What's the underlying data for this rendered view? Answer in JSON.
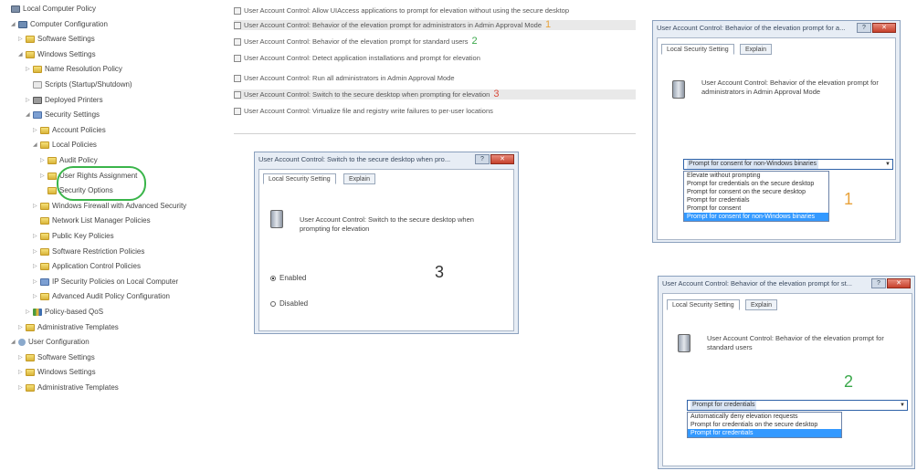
{
  "tree": [
    {
      "label": "Local Computer Policy",
      "icon": "policy-icon",
      "indent": 0,
      "expander": ""
    },
    {
      "label": "Computer Configuration",
      "icon": "computer-icon",
      "indent": 1,
      "expander": "◢"
    },
    {
      "label": "Software Settings",
      "icon": "folder-icon",
      "indent": 2,
      "expander": "▷"
    },
    {
      "label": "Windows Settings",
      "icon": "folder-icon",
      "indent": 2,
      "expander": "◢"
    },
    {
      "label": "Name Resolution Policy",
      "icon": "folder-icon",
      "indent": 3,
      "expander": "▷"
    },
    {
      "label": "Scripts (Startup/Shutdown)",
      "icon": "doc-icon",
      "indent": 3,
      "expander": ""
    },
    {
      "label": "Deployed Printers",
      "icon": "printer-icon",
      "indent": 3,
      "expander": "▷"
    },
    {
      "label": "Security Settings",
      "icon": "shield-icon",
      "indent": 3,
      "expander": "◢"
    },
    {
      "label": "Account Policies",
      "icon": "folder-icon",
      "indent": 4,
      "expander": "▷"
    },
    {
      "label": "Local Policies",
      "icon": "folder-icon",
      "indent": 4,
      "expander": "◢"
    },
    {
      "label": "Audit Policy",
      "icon": "folder-icon",
      "indent": 5,
      "expander": "▷"
    },
    {
      "label": "User Rights Assignment",
      "icon": "folder-icon",
      "indent": 5,
      "expander": "▷"
    },
    {
      "label": "Security Options",
      "icon": "folder-icon",
      "indent": 5,
      "expander": ""
    },
    {
      "label": "Windows Firewall with Advanced Security",
      "icon": "folder-icon",
      "indent": 4,
      "expander": "▷"
    },
    {
      "label": "Network List Manager Policies",
      "icon": "folder-icon",
      "indent": 4,
      "expander": ""
    },
    {
      "label": "Public Key Policies",
      "icon": "folder-icon",
      "indent": 4,
      "expander": "▷"
    },
    {
      "label": "Software Restriction Policies",
      "icon": "folder-icon",
      "indent": 4,
      "expander": "▷"
    },
    {
      "label": "Application Control Policies",
      "icon": "folder-icon",
      "indent": 4,
      "expander": "▷"
    },
    {
      "label": "IP Security Policies on Local Computer",
      "icon": "shield-icon",
      "indent": 4,
      "expander": "▷"
    },
    {
      "label": "Advanced Audit Policy Configuration",
      "icon": "folder-icon",
      "indent": 4,
      "expander": "▷"
    },
    {
      "label": "Policy-based QoS",
      "icon": "chart-icon",
      "indent": 3,
      "expander": "▷"
    },
    {
      "label": "Administrative Templates",
      "icon": "folder-icon",
      "indent": 2,
      "expander": "▷"
    },
    {
      "label": "User Configuration",
      "icon": "user-icon",
      "indent": 1,
      "expander": "◢"
    },
    {
      "label": "Software Settings",
      "icon": "folder-icon",
      "indent": 2,
      "expander": "▷"
    },
    {
      "label": "Windows Settings",
      "icon": "folder-icon",
      "indent": 2,
      "expander": "▷"
    },
    {
      "label": "Administrative Templates",
      "icon": "folder-icon",
      "indent": 2,
      "expander": "▷"
    }
  ],
  "policies": [
    {
      "label": "User Account Control: Allow UIAccess applications to prompt for elevation without using the secure desktop",
      "selected": false,
      "marker": ""
    },
    {
      "label": "User Account Control: Behavior of the elevation prompt for administrators in Admin Approval Mode",
      "selected": true,
      "marker": "1"
    },
    {
      "label": "User Account Control: Behavior of the elevation prompt for standard users",
      "selected": false,
      "marker": "2"
    },
    {
      "label": "User Account Control: Detect application installations and prompt for elevation",
      "selected": false,
      "marker": ""
    },
    {
      "label": "User Account Control: Run all administrators in Admin Approval Mode",
      "selected": false,
      "marker": ""
    },
    {
      "label": "User Account Control: Switch to the secure desktop when prompting for elevation",
      "selected": true,
      "marker": "3"
    },
    {
      "label": "User Account Control: Virtualize file and registry write failures to per-user locations",
      "selected": false,
      "marker": ""
    }
  ],
  "marker_colors": {
    "1": "#e8a23a",
    "2": "#3aa84a",
    "3": "#d94a3a"
  },
  "dialog3": {
    "title": "User Account Control: Switch to the secure desktop when pro...",
    "tab_local": "Local Security Setting",
    "tab_explain": "Explain",
    "description": "User Account Control: Switch to the secure desktop when prompting for elevation",
    "radio_enabled": "Enabled",
    "radio_disabled": "Disabled",
    "marker": "3",
    "help_glyph": "?",
    "close_glyph": "✕"
  },
  "dialog1": {
    "title": "User Account Control: Behavior of the elevation prompt for a...",
    "tab_local": "Local Security Setting",
    "tab_explain": "Explain",
    "description": "User Account Control: Behavior of the elevation prompt for administrators in Admin Approval Mode",
    "combo_value": "Prompt for consent for non-Windows binaries",
    "options": [
      "Elevate without prompting",
      "Prompt for credentials on the secure desktop",
      "Prompt for consent on the secure desktop",
      "Prompt for credentials",
      "Prompt for consent",
      "Prompt for consent for non-Windows binaries"
    ],
    "selected_index": 5,
    "marker": "1",
    "help_glyph": "?",
    "close_glyph": "✕"
  },
  "dialog2": {
    "title": "User Account Control: Behavior of the elevation prompt for st...",
    "tab_local": "Local Security Setting",
    "tab_explain": "Explain",
    "description": "User Account Control: Behavior of the elevation prompt for standard users",
    "combo_value": "Prompt for credentials",
    "options": [
      "Automatically deny elevation requests",
      "Prompt for credentials on the secure desktop",
      "Prompt for credentials"
    ],
    "selected_index": 2,
    "marker": "2",
    "help_glyph": "?",
    "close_glyph": "✕"
  },
  "highlight_color": "#3ab54a"
}
